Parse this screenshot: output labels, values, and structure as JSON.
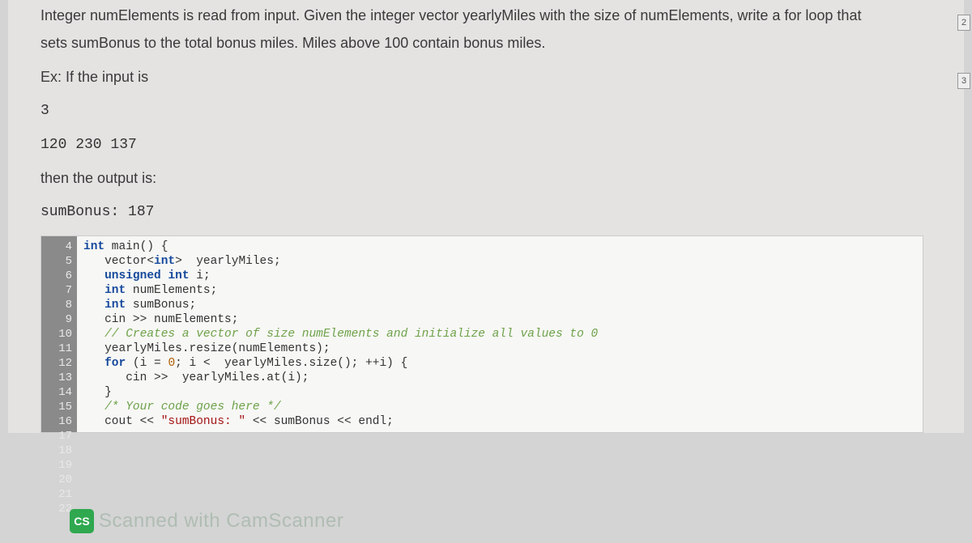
{
  "problem": {
    "description_1": "Integer numElements is read from input. Given the integer vector yearlyMiles with the size of numElements, write a for loop that",
    "description_2": "sets sumBonus to the total bonus miles. Miles above 100 contain bonus miles.",
    "example_label": "Ex: If the input is",
    "input_line1": "3",
    "input_line2": "120 230 137",
    "output_label": "then the output is:",
    "output_line": "sumBonus: 187"
  },
  "code": {
    "lines": [
      {
        "n": "4",
        "text": "",
        "cls": ""
      },
      {
        "n": "5",
        "html": "<span class='kw'>int</span> main() {"
      },
      {
        "n": "6",
        "html": "   vector&lt;<span class='type'>int</span>&gt;  yearlyMiles;"
      },
      {
        "n": "7",
        "html": "   <span class='kw'>unsigned</span> <span class='kw'>int</span> i;"
      },
      {
        "n": "8",
        "html": "   <span class='kw'>int</span> numElements;"
      },
      {
        "n": "9",
        "html": "   <span class='kw'>int</span> sumBonus;"
      },
      {
        "n": "10",
        "html": ""
      },
      {
        "n": "11",
        "html": "   cin &gt;&gt; numElements;"
      },
      {
        "n": "12",
        "html": "   <span class='cmnt'>// Creates a vector of size numElements and initialize all values to 0</span>"
      },
      {
        "n": "13",
        "html": "   yearlyMiles.resize(numElements);"
      },
      {
        "n": "14",
        "html": ""
      },
      {
        "n": "15",
        "html": "   <span class='kw'>for</span> (i = <span class='num'>0</span>; i &lt;  yearlyMiles.size(); ++i) {"
      },
      {
        "n": "16",
        "html": "      cin &gt;&gt;  yearlyMiles.at(i);"
      },
      {
        "n": "17",
        "html": "   }"
      },
      {
        "n": "18",
        "html": ""
      },
      {
        "n": "19",
        "html": "   <span class='cmnt'>/* Your code goes here */</span>"
      },
      {
        "n": "20",
        "html": ""
      },
      {
        "n": "21",
        "html": "   cout &lt;&lt; <span class='str'>\"sumBonus: \"</span> &lt;&lt; sumBonus &lt;&lt; endl;"
      },
      {
        "n": "22",
        "html": ""
      }
    ]
  },
  "watermark": {
    "logo": "CS",
    "text": "Scanned with CamScanner"
  },
  "side": {
    "b1": "2",
    "b2": "3"
  }
}
